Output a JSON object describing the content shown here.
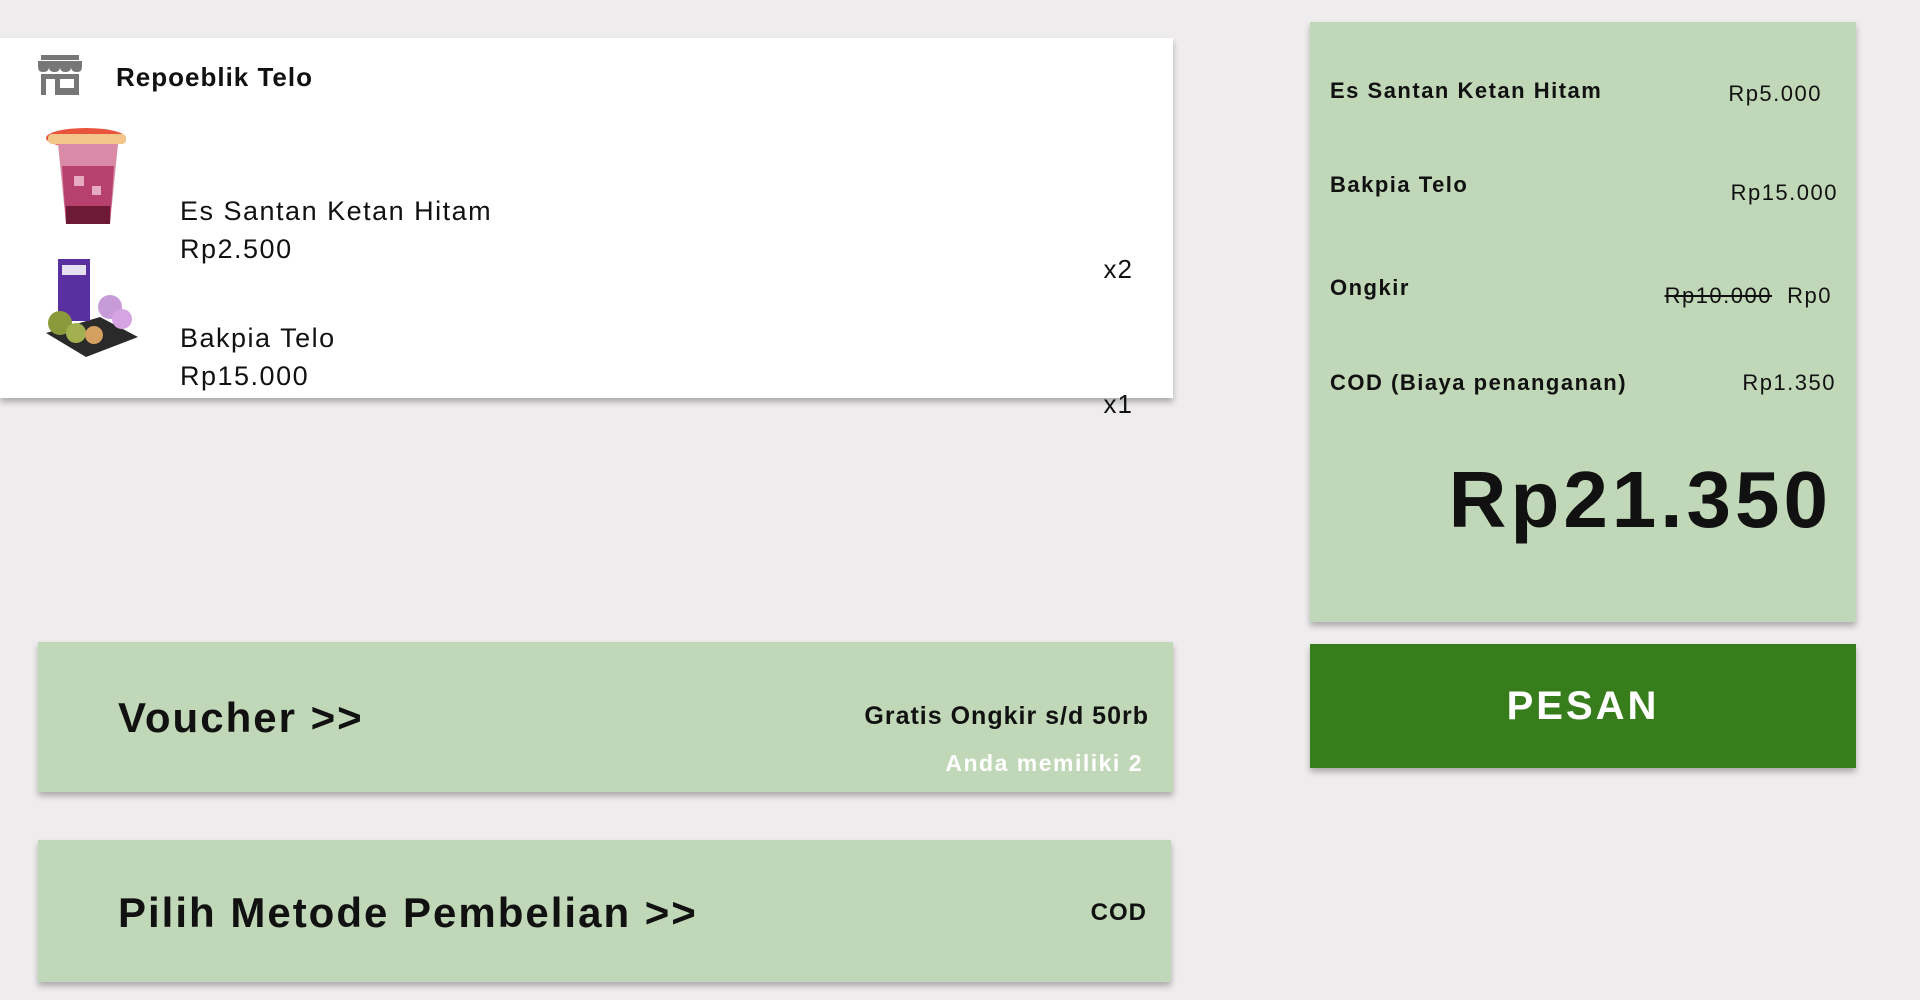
{
  "store": {
    "name": "Repoeblik Telo",
    "icon": "store-icon"
  },
  "cart": {
    "items": [
      {
        "name": "Es Santan Ketan Hitam",
        "price": "Rp2.500",
        "qty": "x2",
        "image": "iced-drink-image"
      },
      {
        "name": "Bakpia Telo",
        "price": "Rp15.000",
        "qty": "x1",
        "image": "bakpia-box-image"
      }
    ]
  },
  "voucher": {
    "title": "Voucher >>",
    "description": "Gratis Ongkir s/d 50rb",
    "count": "Anda memiliki 2"
  },
  "method": {
    "title": "Pilih Metode Pembelian >>",
    "value": "COD"
  },
  "summary": {
    "rows": [
      {
        "label": "Es Santan Ketan Hitam",
        "value": "Rp5.000"
      },
      {
        "label": "Bakpia Telo",
        "value": "Rp15.000"
      },
      {
        "label": "Ongkir",
        "original": "Rp10.000",
        "value": "Rp0"
      },
      {
        "label": "COD (Biaya penanganan)",
        "value": "Rp1.350"
      }
    ],
    "total": "Rp21.350"
  },
  "order_button": {
    "label": "PESAN"
  },
  "colors": {
    "background": "#eeeced",
    "panel_green": "#c0d8b8",
    "button_green": "#377d1c",
    "card_white": "#ffffff"
  }
}
